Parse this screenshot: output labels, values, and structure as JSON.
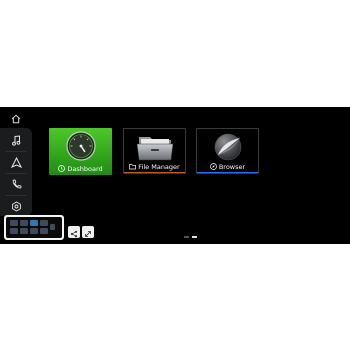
{
  "icons": {
    "home": "home-icon",
    "music": "music-note-icon",
    "navigation": "navigation-arrow-icon",
    "phone": "phone-icon",
    "settings": "settings-icon",
    "share": "share-icon",
    "expand": "expand-icon"
  },
  "apps": [
    {
      "label": "Dashboard",
      "icon": "dashboard-icon"
    },
    {
      "label": "File Manager",
      "icon": "folder-icon"
    },
    {
      "label": "Browser",
      "icon": "compass-icon"
    }
  ],
  "pager": {
    "total": 2,
    "current": 2
  },
  "colors": {
    "dashboard_tile": "#36b11f",
    "file_manager_accent": "#c05a28",
    "browser_accent": "#2a6cff",
    "screen_background": "#000000"
  }
}
